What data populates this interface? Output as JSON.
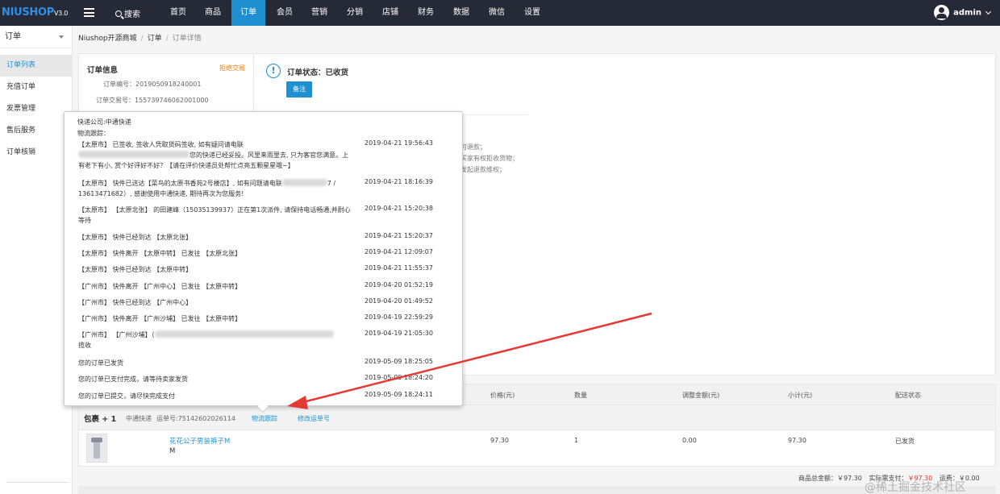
{
  "app": {
    "logo_brand": "NIUSHOP",
    "logo_version": "V3.0"
  },
  "topbar": {
    "search_label": "搜索",
    "nav": [
      {
        "label": "首页"
      },
      {
        "label": "商品"
      },
      {
        "label": "订单",
        "active": true
      },
      {
        "label": "会员"
      },
      {
        "label": "营销"
      },
      {
        "label": "分销"
      },
      {
        "label": "店铺"
      },
      {
        "label": "财务"
      },
      {
        "label": "数据"
      },
      {
        "label": "微信"
      },
      {
        "label": "设置"
      }
    ],
    "user": "admin"
  },
  "sidebar": {
    "heading": "订单",
    "items": [
      {
        "label": "订单列表",
        "active": true
      },
      {
        "label": "充值订单"
      },
      {
        "label": "发票管理"
      },
      {
        "label": "售后服务"
      },
      {
        "label": "订单核销"
      }
    ]
  },
  "breadcrumb": [
    "Niushop开源商城",
    "订单",
    "订单详情"
  ],
  "order_info": {
    "title": "订单信息",
    "action_link": "拒绝交易",
    "order_no_label": "订单编号：",
    "order_no": "2019050918240001",
    "trade_no_label": "订单交易号：",
    "trade_no": "155739746062001000"
  },
  "order_status": {
    "icon": "!",
    "text": "订单状态：已收货",
    "note_button": "备注",
    "policy_lines": [
      "可退款；",
      "买家有权拒收货物；",
      "发起退款维权；"
    ]
  },
  "logistics_popover": {
    "company": "快递公司:中通快递",
    "tracking_label": "物流跟踪：",
    "events": [
      {
        "desc_before": "【太原市】 已签收, 签收人凭取货码签收, 如有疑问请电联",
        "desc_after": "您的快递已经妥投。风里来雨里去, 只为客官您满意。上有老下有小, 赏个好评好不好？【请在评价快递员处帮忙点亮五颗星星哦~】",
        "time": "2019-04-21 19:56:43",
        "redacted": true
      },
      {
        "desc_before": "【太原市】 快件已送达【菜鸟的太原书香苑2号楼店】, 如有问题请电联",
        "desc_after": "7 / 13613471682）, 感谢使用中通快递, 期待再次为您服务!",
        "time": "2019-04-21 18:16:39",
        "redacted": true
      },
      {
        "desc_before": "【太原市】 【太原北张】 的田建峰（15035139937）正在第1次派件, 请保持电话畅通,并耐心等待",
        "desc_after": "",
        "time": "2019-04-21 15:20:38",
        "redacted": false
      },
      {
        "desc_before": "【太原市】 快件已经到达 【太原北张】",
        "desc_after": "",
        "time": "2019-04-21 15:20:37",
        "redacted": false
      },
      {
        "desc_before": "【太原市】 快件离开 【太原中转】 已发往 【太原北张】",
        "desc_after": "",
        "time": "2019-04-21 12:09:07",
        "redacted": false
      },
      {
        "desc_before": "【太原市】 快件已经到达 【太原中转】",
        "desc_after": "",
        "time": "2019-04-21 11:55:37",
        "redacted": false
      },
      {
        "desc_before": "【广州市】 快件离开 【广州中心】 已发往 【太原中转】",
        "desc_after": "",
        "time": "2019-04-20 01:52:19",
        "redacted": false
      },
      {
        "desc_before": "【广州市】 快件已经到达 【广州中心】",
        "desc_after": "",
        "time": "2019-04-20 01:49:52",
        "redacted": false
      },
      {
        "desc_before": "【广州市】 快件离开 【广州沙埔】 已发往 【太原中转】",
        "desc_after": "",
        "time": "2019-04-19 22:59:29",
        "redacted": false
      },
      {
        "desc_before": "【广州市】 【广州沙埔】（",
        "desc_after": "揽收",
        "time": "2019-04-19 21:05:30",
        "redacted": true
      },
      {
        "desc_before": "您的订单已发货",
        "desc_after": "",
        "time": "2019-05-09 18:25:05",
        "redacted": false
      },
      {
        "desc_before": "您的订单已支付完成，请等待卖家发货",
        "desc_after": "",
        "time": "2019-05-09 18:24:20",
        "redacted": false
      },
      {
        "desc_before": "您的订单已提交，请尽快完成支付",
        "desc_after": "",
        "time": "2019-05-09 18:24:11",
        "redacted": false
      }
    ]
  },
  "table": {
    "headers": [
      "价格(元)",
      "数量",
      "调整金额(元)",
      "小计(元)",
      "配送状态"
    ],
    "package": {
      "title": "包裹 + 1",
      "carrier": "中通快递",
      "waybill": "运单号:75142602026114",
      "track_link": "物流跟踪",
      "edit_link": "修改运单号"
    },
    "rows": [
      {
        "name": "花花公子男装裤子M",
        "spec": "M",
        "price": "97.30",
        "qty": "1",
        "adjust": "0.00",
        "subtotal": "97.30",
        "status": "已发货"
      }
    ]
  },
  "totals": {
    "goods_total": "商品总金额：￥97.30",
    "order_total_label": "实际需支付：",
    "order_total": "￥97.30",
    "shipping": "运费：￥0.00"
  },
  "watermark": "@稀土掘金技术社区",
  "colors": {
    "topbar": "#262a36",
    "accent": "#1e90d2",
    "warning": "#ff7a00",
    "annotation_arrow": "#e53935"
  }
}
